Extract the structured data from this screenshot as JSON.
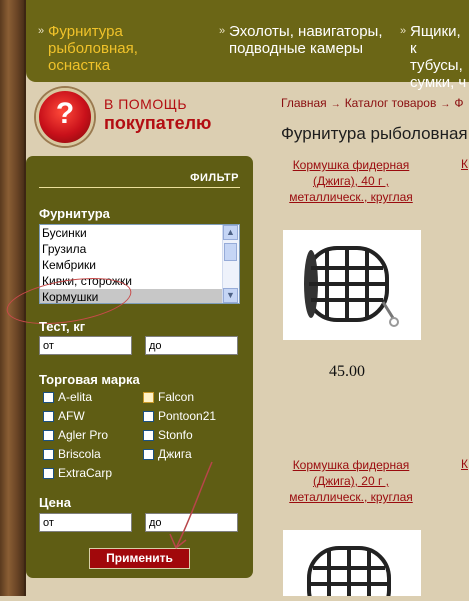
{
  "topnav": {
    "items": [
      {
        "label": "Фурнитура рыболовная, оснастка"
      },
      {
        "label": "Эхолоты, навигаторы, подводные камеры"
      },
      {
        "label": "Ящики, к тубусы, сумки, ч"
      }
    ]
  },
  "help": {
    "line1": "В ПОМОЩЬ",
    "line2": "покупателю",
    "icon_glyph": "?"
  },
  "breadcrumb": {
    "items": [
      "Главная",
      "Каталог товаров",
      "Ф"
    ]
  },
  "page_title": "Фурнитура рыболовная",
  "filter": {
    "title": "ФИЛЬТР",
    "category_label": "Фурнитура",
    "options": [
      "Бусинки",
      "Грузила",
      "Кембрики",
      "Кивки, сторожки",
      "Кормушки"
    ],
    "selected": "Кормушки",
    "test_label": "Тест, кг",
    "test_from": "от",
    "test_to": "до",
    "brand_label": "Торговая марка",
    "brands_left": [
      "A-elita",
      "AFW",
      "Agler Pro",
      "Briscola",
      "ExtraCarp"
    ],
    "brands_right": [
      "Falcon",
      "Pontoon21",
      "Stonfo",
      "Джига"
    ],
    "price_label": "Цена",
    "price_from": "от",
    "price_to": "до",
    "apply_label": "Применить"
  },
  "products": [
    {
      "title": "Кормушка фидерная (Джига), 40 г , металлическ., круглая",
      "price": "45.00"
    },
    {
      "title": "Кормушка фидерная (Джига), 20 г , металлическ., круглая"
    }
  ],
  "colors": {
    "accent": "#9a0b0e",
    "panel": "#5f5d14",
    "nav": "#6b6616",
    "bg": "#dccfb2"
  }
}
